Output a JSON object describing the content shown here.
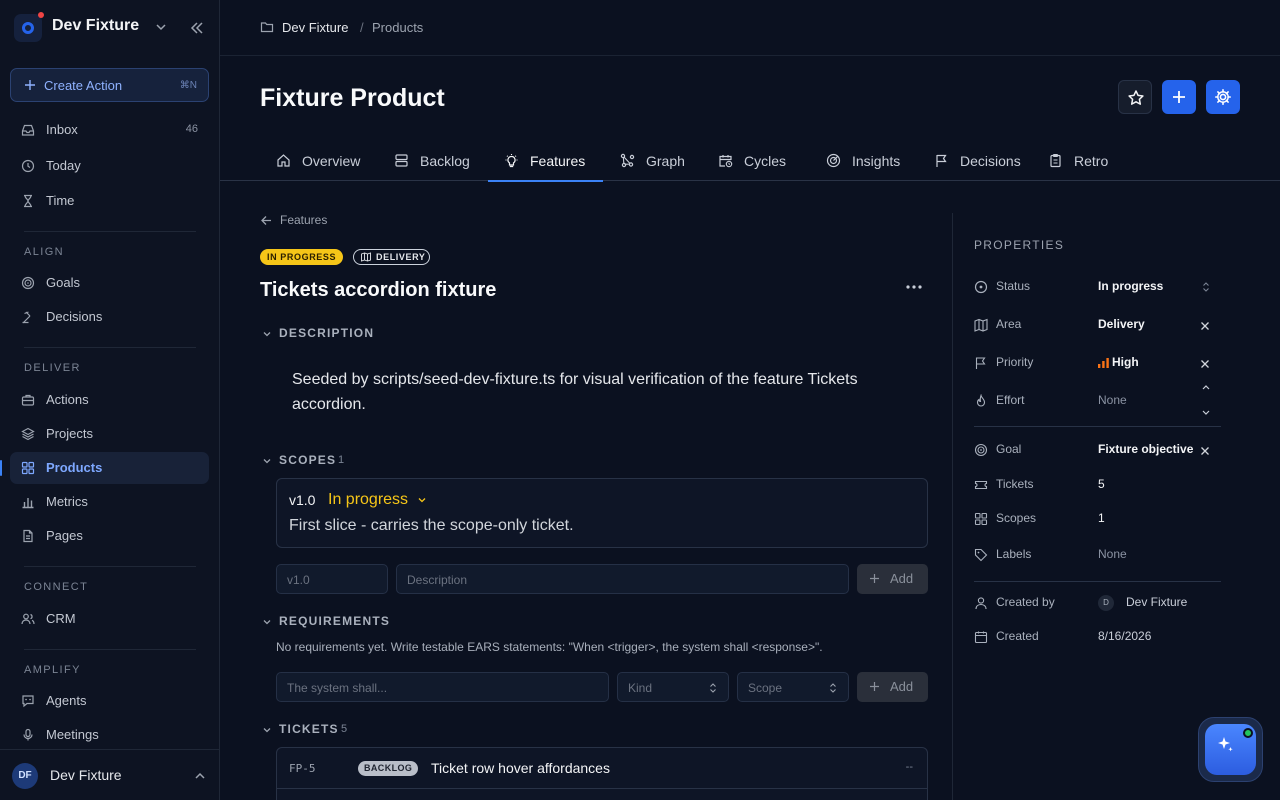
{
  "sidebar": {
    "workspace": "Dev Fixture",
    "create": {
      "label": "Create Action",
      "shortcut": "⌘N"
    },
    "top_items": [
      {
        "label": "Inbox",
        "count": "46",
        "icon": "inbox-icon"
      },
      {
        "label": "Today",
        "icon": "clock-icon"
      },
      {
        "label": "Time",
        "icon": "hourglass-icon"
      }
    ],
    "sections": {
      "align": "ALIGN",
      "deliver": "DELIVER",
      "connect": "CONNECT",
      "amplify": "AMPLIFY"
    },
    "align_items": [
      {
        "label": "Goals",
        "icon": "target-icon"
      },
      {
        "label": "Decisions",
        "icon": "gavel-icon"
      }
    ],
    "deliver_items": [
      {
        "label": "Actions",
        "icon": "briefcase-icon"
      },
      {
        "label": "Projects",
        "icon": "layers-icon"
      },
      {
        "label": "Products",
        "icon": "grid-icon",
        "active": true
      },
      {
        "label": "Metrics",
        "icon": "bar-chart-icon"
      },
      {
        "label": "Pages",
        "icon": "file-icon"
      }
    ],
    "connect_items": [
      {
        "label": "CRM",
        "icon": "users-icon"
      }
    ],
    "amplify_items": [
      {
        "label": "Agents",
        "icon": "message-bot-icon"
      },
      {
        "label": "Meetings",
        "icon": "mic-icon"
      }
    ],
    "user": {
      "initials": "DF",
      "name": "Dev Fixture"
    }
  },
  "breadcrumb": {
    "workspace": "Dev Fixture",
    "sep": "/",
    "page": "Products"
  },
  "page": {
    "title": "Fixture Product"
  },
  "tabs": [
    {
      "label": "Overview",
      "icon": "home-icon"
    },
    {
      "label": "Backlog",
      "icon": "stack-icon"
    },
    {
      "label": "Features",
      "icon": "lightbulb-icon",
      "active": true
    },
    {
      "label": "Graph",
      "icon": "graph-icon"
    },
    {
      "label": "Cycles",
      "icon": "calendar-clock-icon"
    },
    {
      "label": "Insights",
      "icon": "radar-icon"
    },
    {
      "label": "Decisions",
      "icon": "flag-icon"
    },
    {
      "label": "Retro",
      "icon": "clipboard-icon"
    }
  ],
  "feature": {
    "back_label": "Features",
    "status_badge": "IN PROGRESS",
    "area_badge": "DELIVERY",
    "title": "Tickets accordion fixture",
    "description_heading": "DESCRIPTION",
    "description": "Seeded by scripts/seed-dev-fixture.ts for visual verification of the feature Tickets accordion.",
    "scopes_heading": "SCOPES",
    "scopes_count": "1",
    "scope": {
      "version": "v1.0",
      "status": "In progress",
      "text": "First slice - carries the scope-only ticket."
    },
    "scope_form": {
      "version_placeholder": "v1.0",
      "description_placeholder": "Description",
      "add_label": "Add"
    },
    "requirements_heading": "REQUIREMENTS",
    "requirements_hint": "No requirements yet. Write testable EARS statements: \"When <trigger>, the system shall <response>\".",
    "req_form": {
      "statement_placeholder": "The system shall...",
      "kind_placeholder": "Kind",
      "scope_placeholder": "Scope",
      "add_label": "Add"
    },
    "tickets_heading": "TICKETS",
    "tickets_count": "5",
    "tickets": [
      {
        "key": "FP-5",
        "status": "BACKLOG",
        "title": "Ticket row hover affordances",
        "assignee": "--"
      }
    ]
  },
  "properties": {
    "title": "PROPERTIES",
    "status": {
      "label": "Status",
      "value": "In progress"
    },
    "area": {
      "label": "Area",
      "value": "Delivery"
    },
    "priority": {
      "label": "Priority",
      "value": "High"
    },
    "effort": {
      "label": "Effort",
      "value": "None"
    },
    "goal": {
      "label": "Goal",
      "value": "Fixture objective"
    },
    "tickets": {
      "label": "Tickets",
      "value": "5"
    },
    "scopes": {
      "label": "Scopes",
      "value": "1"
    },
    "labels": {
      "label": "Labels",
      "value": "None"
    },
    "created_by": {
      "label": "Created by",
      "initial": "D",
      "value": "Dev Fixture"
    },
    "created": {
      "label": "Created",
      "value": "8/16/2026"
    }
  },
  "colors": {
    "accent": "#2563eb",
    "in_progress": "#f5c518",
    "priority_high": "#f97316",
    "online": "#22c55e"
  }
}
